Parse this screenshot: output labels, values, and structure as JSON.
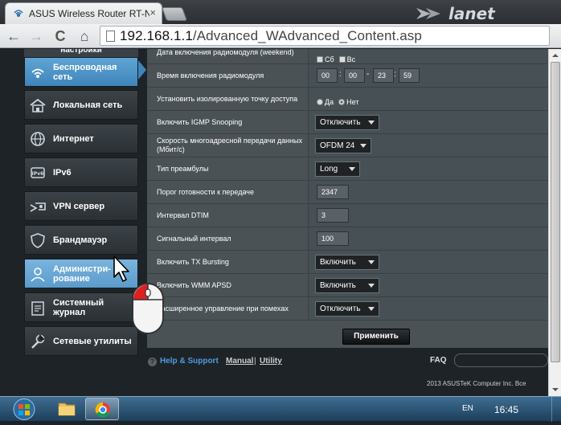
{
  "browser": {
    "tab_title": "ASUS Wireless Router RT-N",
    "tab_close": "×",
    "url_host": "192.168.1.1",
    "url_path": "/Advanced_WAdvanced_Content.asp",
    "nav": {
      "back": "←",
      "forward": "→",
      "reload": "C",
      "home": "⌂"
    },
    "brand_logo": "lanet"
  },
  "sidebar": {
    "header": "настройки",
    "items": [
      {
        "label": "Беспроводная\nсеть",
        "icon": "wifi-icon",
        "active": true
      },
      {
        "label": "Локальная сеть",
        "icon": "home-icon",
        "active": false
      },
      {
        "label": "Интернет",
        "icon": "globe-icon",
        "active": false
      },
      {
        "label": "IPv6",
        "icon": "ipv6-icon",
        "active": false
      },
      {
        "label": "VPN сервер",
        "icon": "vpn-icon",
        "active": false
      },
      {
        "label": "Брандмауэр",
        "icon": "shield-icon",
        "active": false
      },
      {
        "label": "Администри-\nрование",
        "icon": "admin-user-icon",
        "active": false,
        "highlighted": true
      },
      {
        "label": "Системный\nжурнал",
        "icon": "log-icon",
        "active": false
      },
      {
        "label": "Сетевые утилиты",
        "icon": "tools-icon",
        "active": false
      }
    ]
  },
  "settings": {
    "rows": [
      {
        "label": "Дата включения радиомодуля (weekend)",
        "type": "checks",
        "options": [
          "Сб",
          "Вс"
        ]
      },
      {
        "label": "Время включения радиомодуля",
        "type": "time",
        "values": [
          "00",
          "00",
          "23",
          "59"
        ]
      },
      {
        "label": "Установить изолированную точку доступа",
        "type": "radio",
        "options": [
          "Да",
          "Нет"
        ],
        "selected": "Нет"
      },
      {
        "label": "Включить IGMP Snooping",
        "type": "select",
        "value": "Отключить"
      },
      {
        "label": "Скорость многоадресной передачи данных (Мбит/с)",
        "type": "select",
        "value": "OFDM 24"
      },
      {
        "label": "Тип преамбулы",
        "type": "select",
        "value": "Long"
      },
      {
        "label": "Порог готовности к передаче",
        "type": "text",
        "value": "2347"
      },
      {
        "label": "Интервал DTIM",
        "type": "text",
        "value": "3"
      },
      {
        "label": "Сигнальный интервал",
        "type": "text",
        "value": "100"
      },
      {
        "label": "Включить TX Bursting",
        "type": "select",
        "value": "Включить"
      },
      {
        "label": "Включить WMM APSD",
        "type": "select",
        "value": "Включить"
      },
      {
        "label": "Расширенное управление при помехах",
        "type": "select",
        "value": "Отключить"
      }
    ],
    "time_separator": "-",
    "apply_label": "Применить"
  },
  "footer": {
    "help_label": "Help & Support",
    "help_icon": "?",
    "manual_label": "Manual",
    "separator": "|",
    "utility_label": "Utility",
    "faq_label": "FAQ",
    "copyright": "2013  ASUSTeK Computer Inc. Все"
  },
  "taskbar": {
    "language": "EN",
    "clock": "16:45"
  },
  "colors": {
    "active_menu": "#3f85bb",
    "content_bg": "#4b5256",
    "help_link": "#4f9be0",
    "taskbar": "#2a5576"
  }
}
